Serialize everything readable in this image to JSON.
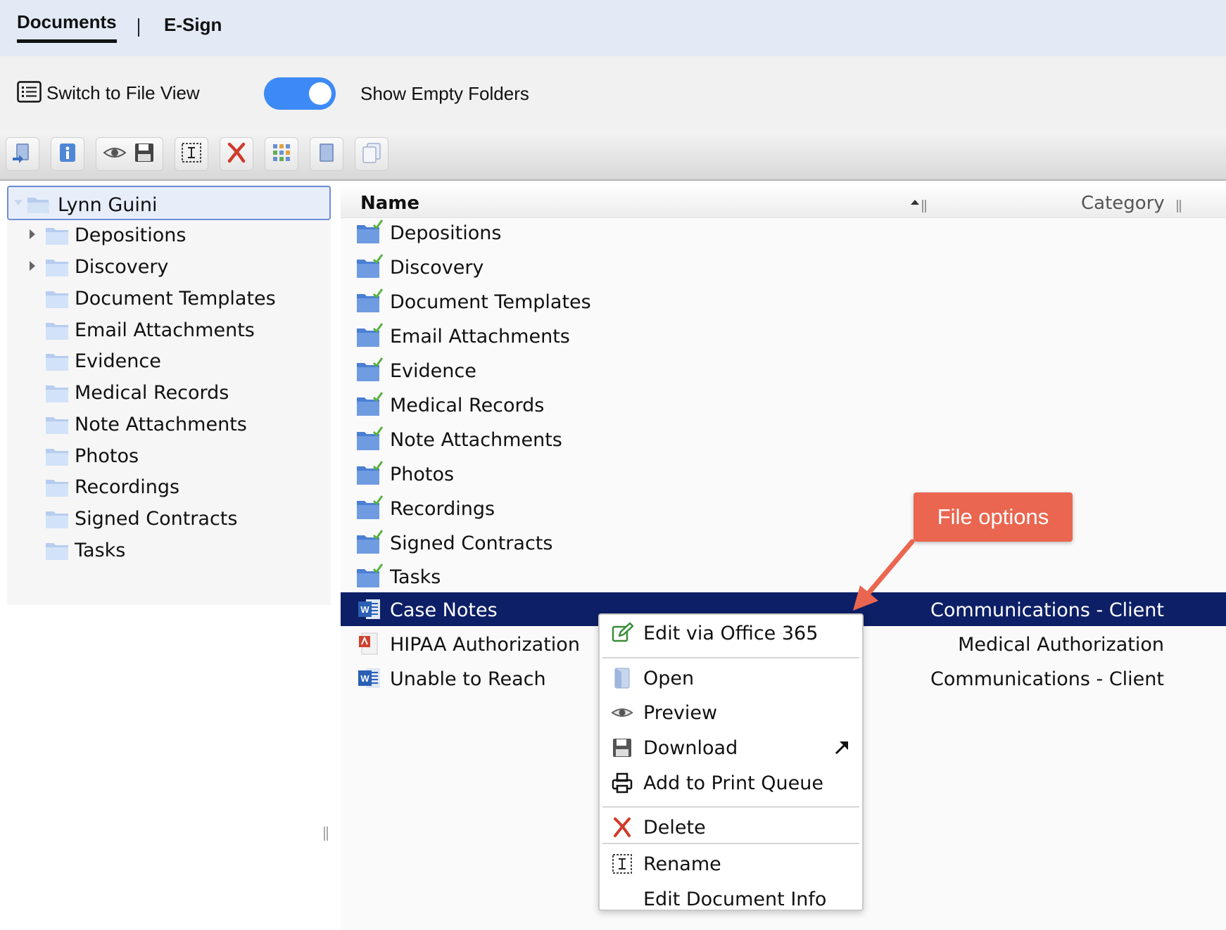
{
  "tabs": {
    "documents": "Documents",
    "esign": "E-Sign"
  },
  "options": {
    "file_view_label": "Switch to File View",
    "show_empty_folders_label": "Show Empty Folders",
    "show_empty_folders_on": true
  },
  "toolbar": {
    "buttons": [
      "upload-icon",
      "info-icon",
      "preview-save-icon",
      "rename-icon",
      "delete-icon",
      "grid-icon",
      "document-icon",
      "copy-icon"
    ]
  },
  "tree": {
    "root": "Lynn Guini",
    "items": [
      {
        "label": "Depositions",
        "expandable": true
      },
      {
        "label": "Discovery",
        "expandable": true
      },
      {
        "label": "Document Templates",
        "expandable": false
      },
      {
        "label": "Email Attachments",
        "expandable": false
      },
      {
        "label": "Evidence",
        "expandable": false
      },
      {
        "label": "Medical Records",
        "expandable": false
      },
      {
        "label": "Note Attachments",
        "expandable": false
      },
      {
        "label": "Photos",
        "expandable": false
      },
      {
        "label": "Recordings",
        "expandable": false
      },
      {
        "label": "Signed Contracts",
        "expandable": false
      },
      {
        "label": "Tasks",
        "expandable": false
      }
    ]
  },
  "list": {
    "columns": {
      "name": "Name",
      "category": "Category"
    },
    "folders": [
      "Depositions",
      "Discovery",
      "Document Templates",
      "Email Attachments",
      "Evidence",
      "Medical Records",
      "Note Attachments",
      "Photos",
      "Recordings",
      "Signed Contracts",
      "Tasks"
    ],
    "files": [
      {
        "name": "Case Notes",
        "category": "Communications - Client",
        "type": "word",
        "selected": true
      },
      {
        "name": "HIPAA Authorization",
        "category": "Medical Authorization",
        "type": "pdf",
        "selected": false
      },
      {
        "name": "Unable to Reach",
        "category": "Communications - Client",
        "type": "word",
        "selected": false
      }
    ]
  },
  "callout": {
    "text": "File options"
  },
  "context_menu": {
    "edit_office": "Edit via Office 365",
    "open": "Open",
    "preview": "Preview",
    "download": "Download",
    "print_queue": "Add to Print Queue",
    "delete": "Delete",
    "rename": "Rename",
    "edit_info": "Edit Document Info"
  },
  "colors": {
    "selected_row": "#0d1f66",
    "toggle_on": "#3d8af7",
    "callout": "#ea6650",
    "tab_bar": "#e3eaf6"
  }
}
